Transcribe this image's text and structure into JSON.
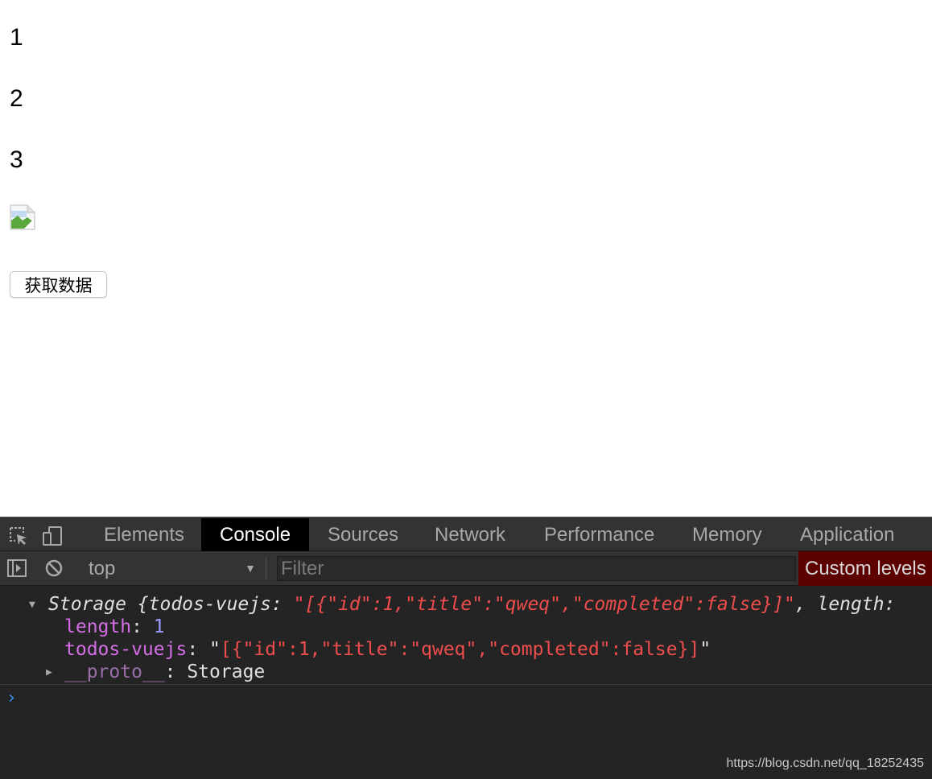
{
  "page": {
    "paragraphs": [
      "1",
      "2",
      "3"
    ],
    "fetch_button_label": "获取数据"
  },
  "devtools": {
    "tabs": [
      {
        "label": "Elements",
        "active": false
      },
      {
        "label": "Console",
        "active": true
      },
      {
        "label": "Sources",
        "active": false
      },
      {
        "label": "Network",
        "active": false
      },
      {
        "label": "Performance",
        "active": false
      },
      {
        "label": "Memory",
        "active": false
      },
      {
        "label": "Application",
        "active": false
      }
    ],
    "toolbar": {
      "context": "top",
      "filter_placeholder": "Filter",
      "levels_label": "Custom levels"
    },
    "console": {
      "summary": {
        "type_name": "Storage",
        "open_brace": " {",
        "key": "todos-vuejs",
        "sep": ": ",
        "value": "\"[{\"id\":1,\"title\":\"qweq\",\"completed\":false}]\"",
        "rest": ", length:"
      },
      "props": [
        {
          "key": "length",
          "sep": ": ",
          "value": "1"
        },
        {
          "key": "todos-vuejs",
          "sep": ": ",
          "quote_open": "\"",
          "value": "[{\"id\":1,\"title\":\"qweq\",\"completed\":false}]",
          "quote_close": "\""
        },
        {
          "key": "__proto__",
          "sep": ": ",
          "value": "Storage"
        }
      ]
    },
    "watermark": "https://blog.csdn.net/qq_18252435"
  },
  "colors": {
    "active_tab_bg": "#000000",
    "levels_bg": "#5c0000",
    "string": "#ee4d4d",
    "key": "#d36ee4",
    "number": "#9b9bff",
    "prompt": "#3d8ef0"
  }
}
